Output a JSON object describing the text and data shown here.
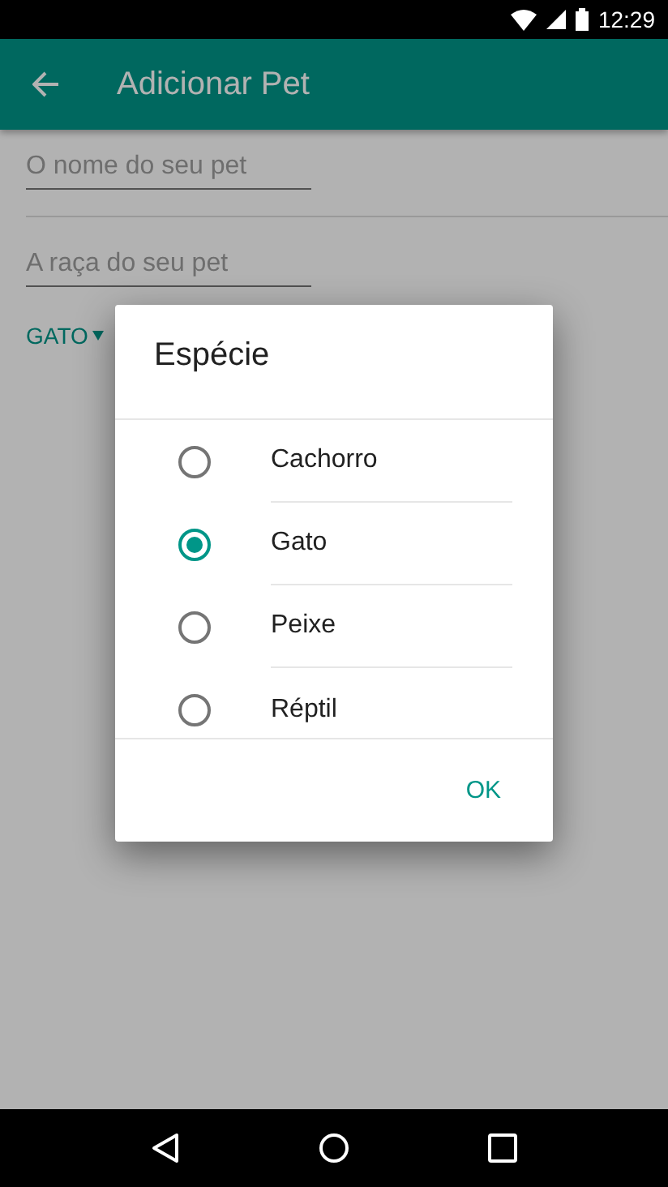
{
  "status_bar": {
    "time": "12:29"
  },
  "app_bar": {
    "title": "Adicionar Pet"
  },
  "form": {
    "fields": [
      {
        "placeholder": "O nome do seu pet"
      },
      {
        "placeholder": "A raça do seu pet"
      }
    ],
    "species_dropdown": {
      "value": "GATO"
    }
  },
  "dialog": {
    "title": "Espécie",
    "options": [
      {
        "label": "Cachorro",
        "selected": false
      },
      {
        "label": "Gato",
        "selected": true
      },
      {
        "label": "Peixe",
        "selected": false
      },
      {
        "label": "Réptil",
        "selected": false
      }
    ],
    "button": "OK"
  }
}
